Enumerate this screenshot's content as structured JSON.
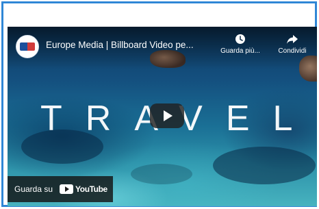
{
  "video": {
    "title": "Europe Media | Billboard Video pe...",
    "overlay_text": "TRAVEL"
  },
  "actions": {
    "watch_later_label": "Guarda più...",
    "share_label": "Condividi"
  },
  "footer": {
    "watch_on_label": "Guarda su",
    "youtube_label": "YouTube"
  },
  "colors": {
    "frame_border": "#2f86d6",
    "water_deep": "#0d3a63",
    "water_shallow": "#47b3bf"
  },
  "icons": {
    "watch_later": "clock-icon",
    "share": "share-arrow-icon",
    "play": "play-icon",
    "youtube": "youtube-logo-icon"
  }
}
